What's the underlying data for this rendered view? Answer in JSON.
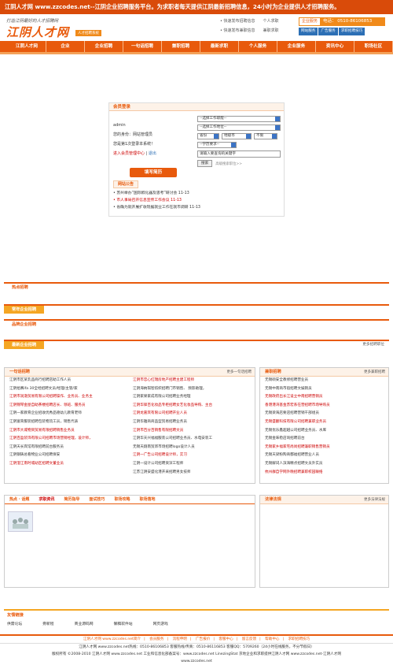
{
  "topbar": {
    "text": "江阴人才网 www.zzcodes.net--江阴企业招聘服务平台。为求职者每天提供江阴最新招聘信息，24小时为企业提供人才招聘服务。"
  },
  "header": {
    "logo_tagline": "打造江阴最好的人才招聘网",
    "logo_text": "江阴人才网",
    "logo_sub": "人才招聘系统",
    "quick_links": [
      [
        "• 快速发布招聘信息",
        "个人求职"
      ],
      [
        "• 快速发布兼职信息",
        "兼职求职"
      ]
    ],
    "service_label": "企业服务",
    "service_phone": "电话： 0510-86106853",
    "service_buttons": [
      "网站服务",
      "广告服务",
      "求职招聘技巧"
    ]
  },
  "nav": {
    "items": [
      "江阴人才网",
      "企业",
      "企业招聘",
      "一句话招聘",
      "兼职招聘",
      "最新求职",
      "个人服务",
      "企业服务",
      "资讯中心",
      "职场社区"
    ]
  },
  "login": {
    "title": "会员登录",
    "lines": [
      "admin",
      "您的身份：网站管理员",
      "您是第1次登录本系统！"
    ],
    "links": [
      "进入会员管理中心",
      "退出"
    ],
    "selects": [
      "--选择工作职能--",
      "--选择工作地位--"
    ],
    "select_row": [
      "省份",
      "地级市",
      "不限"
    ],
    "edu_select": "--学历要求--",
    "keyword_placeholder": "请输入要查询的关键字",
    "search_button": "搜索",
    "advanced": "高级搜索职位>>",
    "post_button": "填写简历",
    "notice_tab": "网站公告",
    "notices": [
      {
        "text": "苏州举办“国际孵化器及思考”研讨会  11-13",
        "hl": false
      },
      {
        "text": "市人事局召开信息宣传工作会议  11-13",
        "hl": true
      },
      {
        "text": "省确为就开展扩收现据就业工作在就市调研  11-13",
        "hl": false
      }
    ]
  },
  "sections": {
    "hot": "热点招聘",
    "ordinary": "常年企业招聘",
    "brand": "品牌企业招聘",
    "recent": "最新企业招聘",
    "recent_more": "更多招聘职位"
  },
  "oneline": {
    "title": "一句话招聘",
    "more": "更多一句话招聘",
    "left": [
      {
        "t": "江阴市区某乳品商行招聘店助工作人员",
        "c": ""
      },
      {
        "t": "江阴拾赛ifa 30全经招聘文员/经理/主管/家",
        "c": ""
      },
      {
        "t": "江阴市润渤贸易有限公司招聘操作、业务员、业务主",
        "c": "r"
      },
      {
        "t": "江阴锦琴金屋自助茶楼招聘店长、领班、服务员",
        "c": "r"
      },
      {
        "t": "江阴一家教育企业招收优秀品德幼儿教育老师",
        "c": ""
      },
      {
        "t": "江阴富荣服装招聘包装物流工员，销售代表",
        "c": ""
      },
      {
        "t": "江阴市大城物资贸易有限招聘销售业务员",
        "c": "r"
      },
      {
        "t": "江阴百盈装饰有限公司招聘市场营销经理，设计师，",
        "c": "r"
      },
      {
        "t": "江阴天长宾馆有限招聘前台服务员",
        "c": ""
      },
      {
        "t": "江阴钢铸总看物业公司招聘保安",
        "c": ""
      },
      {
        "t": "江阴澄江南时城幼区招聘文董业员",
        "c": "r"
      }
    ],
    "middle": [
      {
        "t": "江阴市忠心红瑞房地产招聘主建工程师",
        "c": "r"
      },
      {
        "t": "江阴海纳琪智纺织招聘门市销售、 频影助理，",
        "c": ""
      },
      {
        "t": "江阴家果家成有限公司招聘业务经理",
        "c": ""
      },
      {
        "t": "江阴华锋百化妆品专柜招聘女艺化妆品导购、主台",
        "c": "r"
      },
      {
        "t": "江阴龙嘉宾有限公司招聘开业人员",
        "c": "r"
      },
      {
        "t": "江阴华雅商商品型贸易招聘业务员",
        "c": ""
      },
      {
        "t": "江阴市百分百销售有限招聘文员",
        "c": "r"
      },
      {
        "t": "江阴华天兴福福服装公司招聘业务员、水电安装工",
        "c": ""
      },
      {
        "t": "无锡天翔南贸饰市场招聘logo设计人员",
        "c": ""
      },
      {
        "t": "江阴一广告公司招聘设计师，实习",
        "c": "r"
      },
      {
        "t": "江阴一设计公司招聘资深工程师",
        "c": ""
      },
      {
        "t": "江苏江阴安盛化港开采招聘男女技师",
        "c": ""
      }
    ],
    "right_title": "兼职招聘",
    "right_more": "更多兼职招聘",
    "right": [
      {
        "t": "无锡硕安全教修招聘营业员",
        "c": ""
      },
      {
        "t": "无锡中南商市宿招聘文娱销员",
        "c": ""
      },
      {
        "t": "无锡政府出长江设立中南招聘营销员",
        "c": "r"
      },
      {
        "t": "香港港湾基金苏宏系在营招聘市场导购员",
        "c": "r"
      },
      {
        "t": "无锡梁海店要店招聘营销干部组员",
        "c": ""
      },
      {
        "t": "无锡盛翻科技有限公司招聘兼职业务员",
        "c": "r"
      },
      {
        "t": "无锡优乐鑫超越公司招聘业务员、水库",
        "c": ""
      },
      {
        "t": "无锡金味稳店询招聘前台",
        "c": ""
      },
      {
        "t": "无锡家乡福家宅尚尚招聘兼职销售营销员",
        "c": "r"
      },
      {
        "t": "无锡天梁粉陶商都福招聘营业人员",
        "c": ""
      },
      {
        "t": "无锡解词人滨海精点招聘文员外实员",
        "c": ""
      },
      {
        "t": "杭州群自学网外晚招聘兼职校园联络",
        "c": "r"
      }
    ]
  },
  "news": {
    "title": "热点 · 话题",
    "tabs": [
      "求职资讯",
      "简历指导",
      "面试技巧",
      "职场攻略",
      "职场落地"
    ],
    "law_title": "法律法规",
    "law_more": "更多法律法规"
  },
  "friend": {
    "title": "友情链接",
    "links": [
      "供需论坛",
      "旁新程",
      "商业源码网",
      "懒稿软件站",
      "网页游戏"
    ]
  },
  "footer": {
    "links": [
      "江阴人才网 www.zzcodes.net简介",
      "会员服务",
      "流程申明",
      "广告报价",
      "客服中心",
      "留言反馈",
      "帮助中心",
      "求职招聘技巧"
    ],
    "line1": "江阴人才网 www.zzcodes.net热线：0510-86106853   客服热线/传真：0510-86116853   客服QQ：5709260（24小时在线服务，不分节假日）",
    "line2": "版权所有 ©2008-2010 江阴人才网 www.zzcodes.net   工业和信息化部备案号：www.zzcodes.net  LinezingStat  京地企业和求职提供江阴人才网 www.zzcodes.net-江阴人才网",
    "line3": "www.zzcodes.net"
  }
}
